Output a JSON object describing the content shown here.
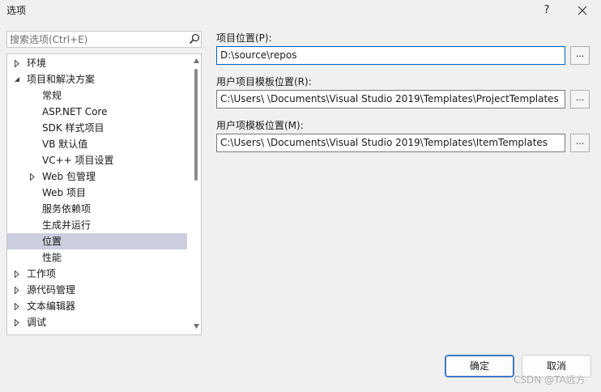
{
  "window": {
    "title": "选项",
    "help_label": "?"
  },
  "search": {
    "placeholder": "搜索选项(Ctrl+E)"
  },
  "tree": {
    "items": [
      {
        "label": "环境",
        "arrow": "expand-right"
      },
      {
        "label": "项目和解决方案",
        "arrow": "expanded-down"
      },
      {
        "label": "常规"
      },
      {
        "label": "ASP.NET Core"
      },
      {
        "label": "SDK 样式项目"
      },
      {
        "label": "VB 默认值"
      },
      {
        "label": "VC++ 项目设置"
      },
      {
        "label": "Web 包管理",
        "arrow": "expand-right"
      },
      {
        "label": "Web 项目"
      },
      {
        "label": "服务依赖项"
      },
      {
        "label": "生成并运行"
      },
      {
        "label": "位置",
        "selected": true
      },
      {
        "label": "性能"
      },
      {
        "label": "工作项",
        "arrow": "expand-right"
      },
      {
        "label": "源代码管理",
        "arrow": "expand-right"
      },
      {
        "label": "文本编辑器",
        "arrow": "expand-right"
      },
      {
        "label": "调试",
        "arrow": "expand-right"
      }
    ]
  },
  "fields": {
    "project_location": {
      "label": "项目位置(P):",
      "value": "D:\\source\\repos"
    },
    "user_project_templates": {
      "label": "用户项目模板位置(R):",
      "value": "C:\\Users\\     \\Documents\\Visual Studio 2019\\Templates\\ProjectTemplates"
    },
    "user_item_templates": {
      "label": "用户项模板位置(M):",
      "value": "C:\\Users\\     \\Documents\\Visual Studio 2019\\Templates\\ItemTemplates"
    },
    "browse_label": "..."
  },
  "buttons": {
    "ok_label": "确定",
    "cancel_label": "取消"
  },
  "watermark": "CSDN @TA远方",
  "colors": {
    "selected_row": "#cbcede",
    "focus_border": "#0060c0",
    "primary_border": "#3d76c6"
  }
}
